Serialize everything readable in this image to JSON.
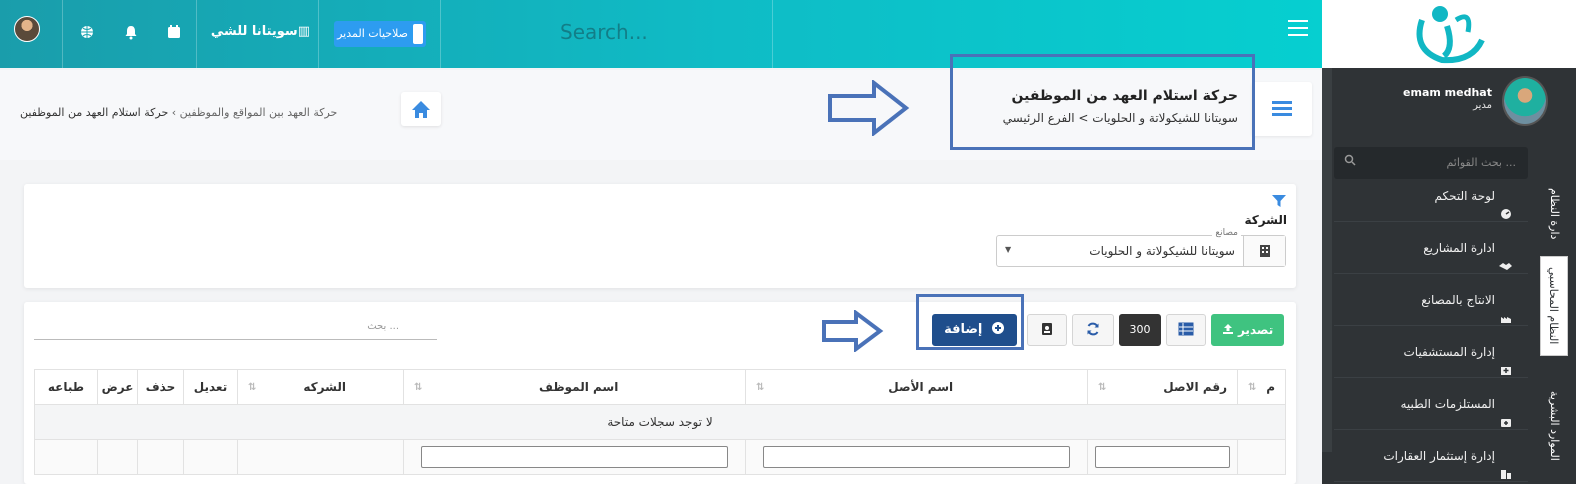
{
  "topbar": {
    "search_placeholder": "Search...",
    "company_name": "سويتانا للشي...",
    "permissions_label": "صلاحيات المدير",
    "colors": {
      "gradient_start": "#1a9dab",
      "gradient_end": "#06cfd0"
    }
  },
  "sidebar": {
    "user_name": "emam medhat",
    "user_role": "مدير",
    "search_placeholder": "بحث القوائم ...",
    "items": [
      {
        "label": "لوحة التحكم",
        "icon": "dashboard-icon"
      },
      {
        "label": "ادارة المشاريع",
        "icon": "handshake-icon"
      },
      {
        "label": "الانتاج بالمصانع",
        "icon": "factory-icon"
      },
      {
        "label": "إدارة المستشفيات",
        "icon": "hospital-icon"
      },
      {
        "label": "المستلزمات الطبيه",
        "icon": "medkit-icon"
      },
      {
        "label": "إدارة إستثمار العقارات",
        "icon": "buildings-icon"
      }
    ],
    "vertical_tabs": [
      "دارة النظام",
      "النظام المحاسبي",
      "الموارد البشرية"
    ]
  },
  "header": {
    "title": "حركة استلام العهد من الموظفين",
    "company": "سويتانا للشيكولاتة و الحلويات",
    "branch": "الفرع الرئيسي",
    "breadcrumb": [
      "حركة العهد بين المواقع والموظفين",
      "حركة استلام العهد من الموظفين"
    ]
  },
  "filter": {
    "label": "الشركة",
    "select_float_label": "مصانع",
    "select_value": "سويتانا للشيكولاتة و الحلويات"
  },
  "toolbar": {
    "export_label": "تصدير",
    "page_size": "300",
    "add_label": "إضافة",
    "search_placeholder": "بحث ..."
  },
  "table": {
    "columns": [
      "م",
      "رقم الاصل",
      "اسم الأصل",
      "اسم الموظف",
      "الشركه",
      "تعديل",
      "حذف",
      "عرض",
      "طباعه"
    ],
    "empty_message": "لا توجد سجلات متاحة"
  }
}
